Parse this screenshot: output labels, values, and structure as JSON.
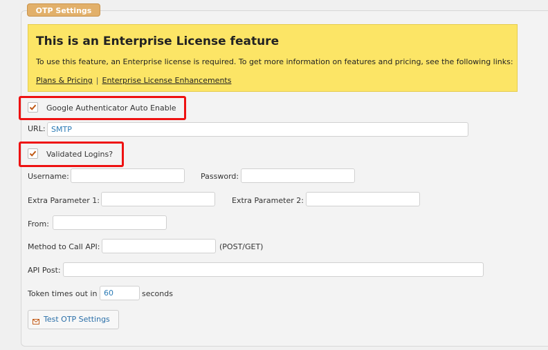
{
  "fieldset": {
    "legend": "OTP Settings"
  },
  "notice": {
    "title": "This is an Enterprise License feature",
    "description": "To use this feature, an Enterprise license is required. To get more information on features and pricing, see the following links:",
    "links": [
      "Plans & Pricing",
      "Enterprise License Enhancements"
    ],
    "separator": "|"
  },
  "google_auth": {
    "label": "Google Authenticator Auto Enable",
    "checked": true
  },
  "url": {
    "label": "URL:",
    "value": "SMTP"
  },
  "validated_logins": {
    "label": "Validated Logins?",
    "checked": true
  },
  "username": {
    "label": "Username:",
    "value": ""
  },
  "password": {
    "label": "Password:",
    "value": ""
  },
  "extra1": {
    "label": "Extra Parameter 1:",
    "value": ""
  },
  "extra2": {
    "label": "Extra Parameter 2:",
    "value": ""
  },
  "from": {
    "label": "From:",
    "value": ""
  },
  "method": {
    "label": "Method to Call API:",
    "value": "",
    "hint": "(POST/GET)"
  },
  "api_post": {
    "label": "API Post:",
    "value": ""
  },
  "token": {
    "label": "Token times out in",
    "value": "60",
    "unit": "seconds"
  },
  "test_button": {
    "label": "Test OTP Settings",
    "icon": "mail-icon"
  },
  "colors": {
    "legend": "#e2b06a",
    "notice": "#fce566",
    "highlight": "#ee1111",
    "check": "#c05a17",
    "link": "#2a6fa8"
  }
}
